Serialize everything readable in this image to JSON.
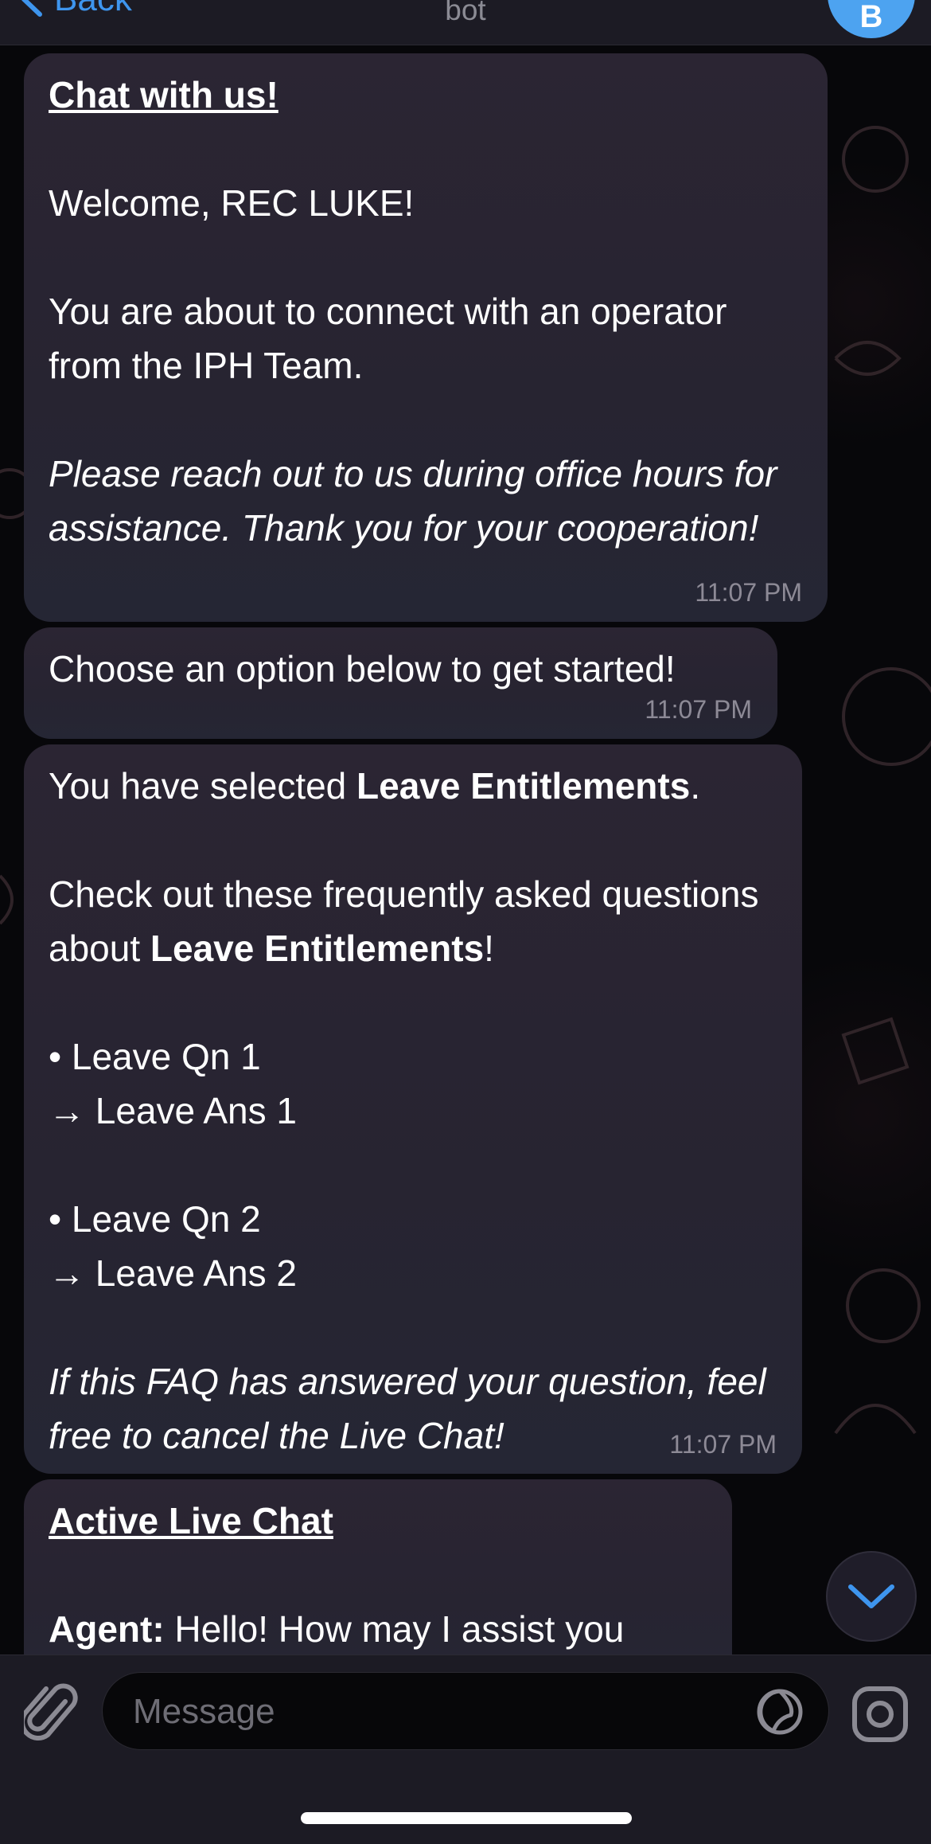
{
  "header": {
    "back_label": "Back",
    "subtitle": "bot",
    "avatar_letter": "B"
  },
  "messages": [
    {
      "title": "Chat with us!",
      "greeting": "Welcome, REC LUKE!",
      "body": "You are about to connect with an operator from the IPH Team.",
      "note": "Please reach out to us during office hours for assistance. Thank you for your cooperation!",
      "time": "11:07 PM"
    },
    {
      "text": "Choose an option below to get started!",
      "time": "11:07 PM"
    },
    {
      "selected_prefix": "You have selected ",
      "topic": "Leave Entitlements",
      "selected_suffix": ".",
      "faq_prefix": "Check out these frequently asked questions about ",
      "faq_suffix": "!",
      "faqs": [
        {
          "question": "• Leave Qn 1",
          "answer": "→ Leave Ans 1"
        },
        {
          "question": "• Leave Qn 2",
          "answer": "→ Leave Ans 2"
        }
      ],
      "closing": "If this FAQ has answered your question, feel free to cancel the Live Chat!",
      "time": "11:07 PM"
    },
    {
      "title": "Active Live Chat",
      "agent_label": "Agent:",
      "agent_text": " Hello! How may I assist you"
    }
  ],
  "composer": {
    "placeholder": "Message"
  },
  "colors": {
    "accent": "#3e95ee",
    "bubble": "#2a2532",
    "background": "#07070a"
  },
  "icons": [
    "chevron-left-icon",
    "paperclip-icon",
    "sticker-icon",
    "camera-icon",
    "chevron-down-icon"
  ]
}
